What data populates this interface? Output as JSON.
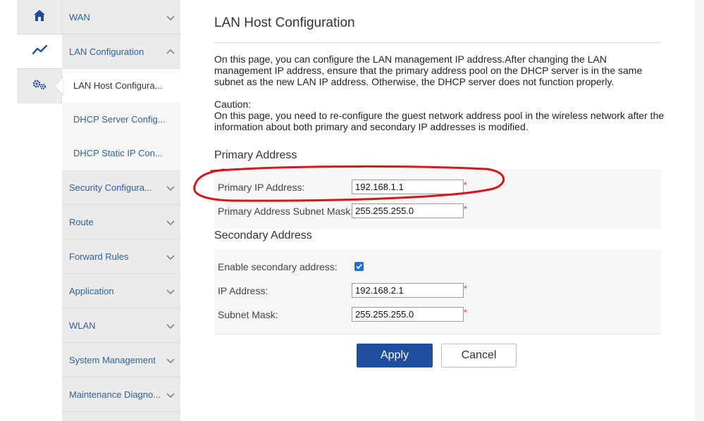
{
  "rail": {
    "items": [
      {
        "icon": "home-icon"
      },
      {
        "icon": "trend-icon"
      },
      {
        "icon": "gears-icon"
      }
    ]
  },
  "nav": {
    "items": [
      {
        "label": "WAN",
        "expanded": false
      },
      {
        "label": "LAN Configuration",
        "expanded": true
      },
      {
        "label": "Security Configura...",
        "expanded": false
      },
      {
        "label": "Route",
        "expanded": false
      },
      {
        "label": "Forward Rules",
        "expanded": false
      },
      {
        "label": "Application",
        "expanded": false
      },
      {
        "label": "WLAN",
        "expanded": false
      },
      {
        "label": "System Management",
        "expanded": false
      },
      {
        "label": "Maintenance Diagno...",
        "expanded": false
      }
    ],
    "sub_items": [
      {
        "label": "LAN Host Configura...",
        "active": true
      },
      {
        "label": "DHCP Server Config...",
        "active": false
      },
      {
        "label": "DHCP Static IP Con...",
        "active": false
      }
    ]
  },
  "page": {
    "title": "LAN Host Configuration",
    "description": "On this page, you can configure the LAN management IP address.After changing the LAN management IP address, ensure that the primary address pool on the DHCP server is in the same subnet as the new LAN IP address. Otherwise, the DHCP server does not function properly.",
    "caution_heading": "Caution:",
    "caution_text": "On this page, you need to re-configure the guest network address pool in the wireless network after the information about both primary and secondary IP addresses is modified."
  },
  "primary": {
    "section_title": "Primary Address",
    "ip_label": "Primary IP Address:",
    "ip_value": "192.168.1.1",
    "mask_label": "Primary Address Subnet Mask:",
    "mask_value": "255.255.255.0"
  },
  "secondary": {
    "section_title": "Secondary Address",
    "enable_label": "Enable secondary address:",
    "enabled": true,
    "ip_label": "IP Address:",
    "ip_value": "192.168.2.1",
    "mask_label": "Subnet Mask:",
    "mask_value": "255.255.255.0"
  },
  "required_mark": "*",
  "buttons": {
    "apply": "Apply",
    "cancel": "Cancel"
  },
  "colors": {
    "accent": "#1f4e9c",
    "nav_link": "#2e62a0",
    "annotation": "#d8141c",
    "required": "#e03030"
  }
}
